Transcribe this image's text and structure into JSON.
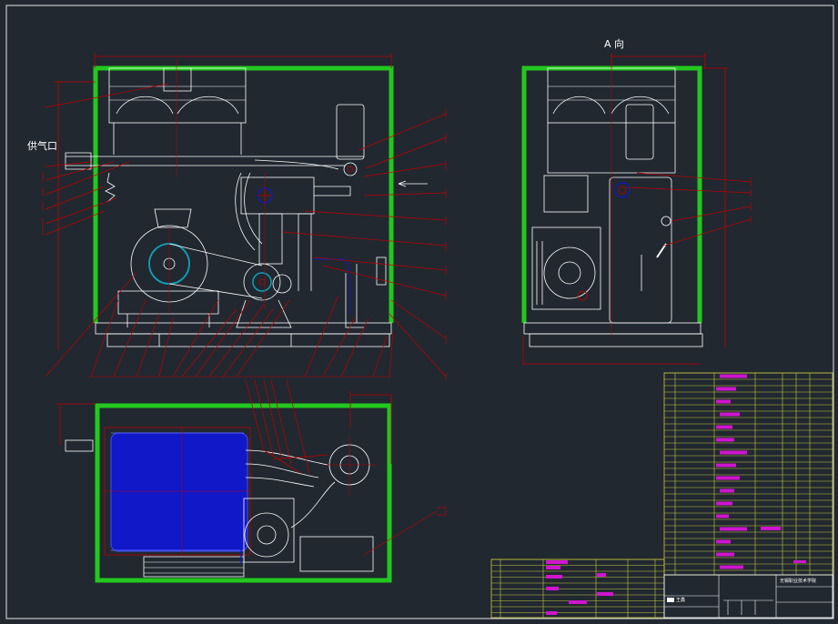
{
  "labels": {
    "gas_supply_port": "供气口",
    "view_a": "A  向",
    "school_name": "无锡职业技术学院",
    "designer": "王鑫"
  },
  "colors": {
    "background": "#212830",
    "frame": "#e6e6e6",
    "enclosure": "#22c81e",
    "outline": "#ffffff",
    "leader": "#c00000",
    "motor_fill": "#1018c8",
    "title_grid": "#c8c83c",
    "highlight": "#d014d0",
    "accent": "#10a0b4"
  }
}
